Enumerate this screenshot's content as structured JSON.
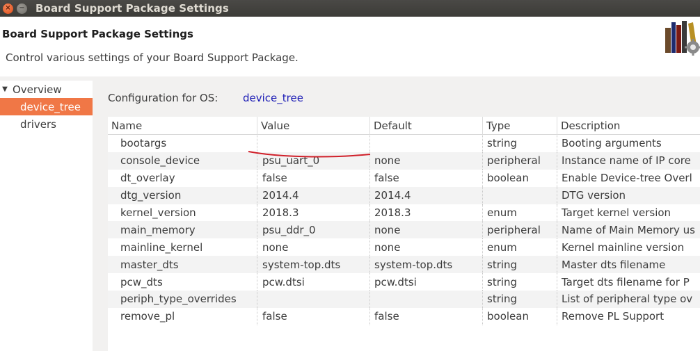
{
  "window": {
    "title": "Board Support Package Settings",
    "close_glyph": "×",
    "maximize_glyph": "−"
  },
  "header": {
    "title": "Board Support Package Settings",
    "description": "Control various settings of your Board Support Package.",
    "icon": "bsp-books-gear-icon"
  },
  "tree": {
    "items": [
      {
        "label": "Overview",
        "expanded": true
      },
      {
        "label": "device_tree",
        "selected": true
      },
      {
        "label": "drivers"
      }
    ]
  },
  "config": {
    "label": "Configuration for OS:",
    "value": "device_tree"
  },
  "table": {
    "headers": [
      "Name",
      "Value",
      "Default",
      "Type",
      "Description"
    ],
    "rows": [
      {
        "name": "bootargs",
        "value": "",
        "default": "",
        "type": "string",
        "description": "Booting arguments"
      },
      {
        "name": "console_device",
        "value": "psu_uart_0",
        "default": "none",
        "type": "peripheral",
        "description": "Instance name of IP core"
      },
      {
        "name": "dt_overlay",
        "value": "false",
        "default": "false",
        "type": "boolean",
        "description": "Enable Device-tree Overl"
      },
      {
        "name": "dtg_version",
        "value": "2014.4",
        "default": "2014.4",
        "type": "",
        "description": "DTG version"
      },
      {
        "name": "kernel_version",
        "value": "2018.3",
        "default": "2018.3",
        "type": "enum",
        "description": "Target kernel version"
      },
      {
        "name": "main_memory",
        "value": "psu_ddr_0",
        "default": "none",
        "type": "peripheral",
        "description": "Name of Main Memory us"
      },
      {
        "name": "mainline_kernel",
        "value": "none",
        "default": "none",
        "type": "enum",
        "description": "Kernel mainline version"
      },
      {
        "name": "master_dts",
        "value": "system-top.dts",
        "default": "system-top.dts",
        "type": "string",
        "description": "Master dts filename"
      },
      {
        "name": "pcw_dts",
        "value": "pcw.dtsi",
        "default": "pcw.dtsi",
        "type": "string",
        "description": "Target dts filename for P"
      },
      {
        "name": "periph_type_overrides",
        "value": "",
        "default": "",
        "type": "string",
        "description": "List of peripheral type ov"
      },
      {
        "name": "remove_pl",
        "value": "false",
        "default": "false",
        "type": "boolean",
        "description": "Remove PL Support"
      }
    ]
  },
  "colors": {
    "selection": "#f07746",
    "link": "#1b1bb5",
    "annotation": "#d0202a"
  }
}
